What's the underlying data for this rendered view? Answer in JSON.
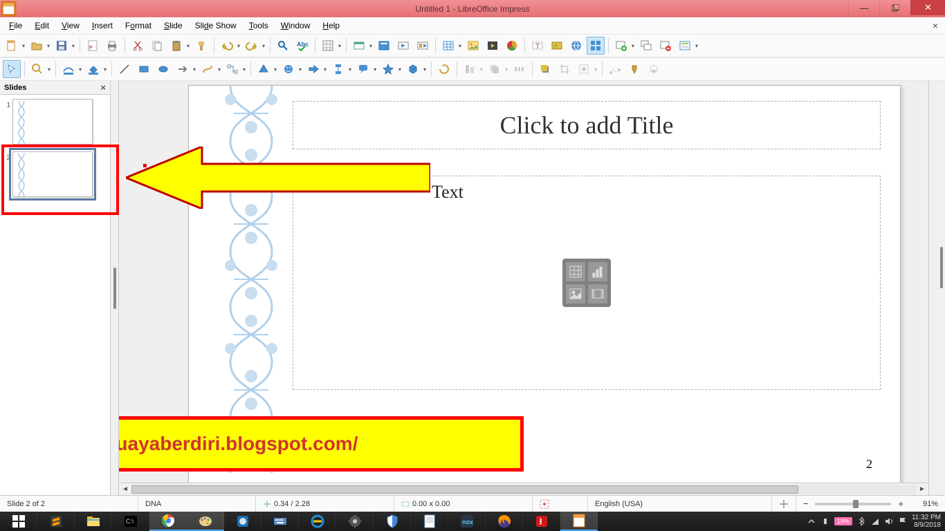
{
  "window": {
    "title": "Untitled 1 - LibreOffice Impress"
  },
  "menu": [
    "File",
    "Edit",
    "View",
    "Insert",
    "Format",
    "Slide",
    "Slide Show",
    "Tools",
    "Window",
    "Help"
  ],
  "slides_panel": {
    "title": "Slides",
    "thumbs": [
      "1",
      "2"
    ],
    "selected": 2
  },
  "canvas": {
    "title_placeholder": "Click to add Title",
    "content_placeholder_tail": " Text",
    "page_number": "2"
  },
  "annotation": {
    "url": "https://buayaberdiri.blogspot.com/"
  },
  "status": {
    "slide": "Slide 2 of 2",
    "master": "DNA",
    "pos": "0.34 / 2.28",
    "size": "0.00 x 0.00",
    "lang": "English (USA)",
    "zoom": "91%"
  },
  "system": {
    "battery": "19%",
    "time": "11:32 PM",
    "date": "8/9/2018"
  }
}
